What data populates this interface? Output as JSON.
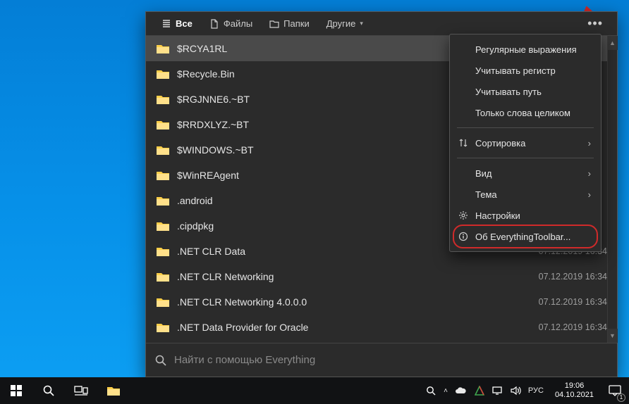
{
  "tabs": {
    "all": "Все",
    "files": "Файлы",
    "folders": "Папки",
    "other": "Другие"
  },
  "results": [
    {
      "name": "$RCYA1RL",
      "date": "",
      "selected": true
    },
    {
      "name": "$Recycle.Bin",
      "date": ""
    },
    {
      "name": "$RGJNNE6.~BT",
      "date": ""
    },
    {
      "name": "$RRDXLYZ.~BT",
      "date": ""
    },
    {
      "name": "$WINDOWS.~BT",
      "date": ""
    },
    {
      "name": "$WinREAgent",
      "date": ""
    },
    {
      "name": ".android",
      "date": ""
    },
    {
      "name": ".cipdpkg",
      "date": ""
    },
    {
      "name": ".NET CLR Data",
      "date": "07.12.2019 16:34"
    },
    {
      "name": ".NET CLR Networking",
      "date": "07.12.2019 16:34"
    },
    {
      "name": ".NET CLR Networking 4.0.0.0",
      "date": "07.12.2019 16:34"
    },
    {
      "name": ".NET Data Provider for Oracle",
      "date": "07.12.2019 16:34"
    }
  ],
  "menu": {
    "regex": "Регулярные выражения",
    "case": "Учитывать регистр",
    "path": "Учитывать путь",
    "wholewords": "Только слова целиком",
    "sort": "Сортировка",
    "view": "Вид",
    "theme": "Тема",
    "settings": "Настройки",
    "about": "Об EverythingToolbar..."
  },
  "search": {
    "placeholder": "Найти с помощью Everything"
  },
  "tray": {
    "lang": "РУС",
    "time": "19:06",
    "date": "04.10.2021",
    "notif_count": "1"
  },
  "colors": {
    "accent_red": "#d02a2a"
  }
}
